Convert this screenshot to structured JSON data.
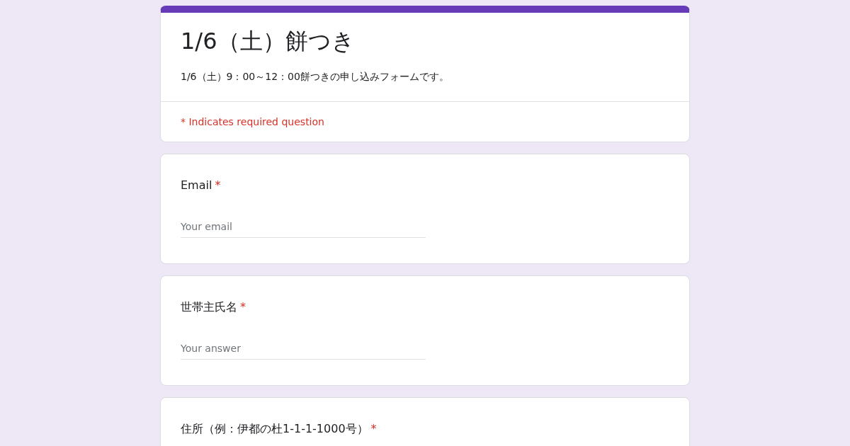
{
  "header": {
    "title": "1/6（土）餅つき",
    "description": "1/6（土）9：00～12：00餅つきの申し込みフォームです。",
    "required_note": "* Indicates required question"
  },
  "questions": [
    {
      "label": "Email",
      "required_mark": "*",
      "placeholder": "Your email"
    },
    {
      "label": "世帯主氏名",
      "required_mark": "*",
      "placeholder": "Your answer"
    },
    {
      "label": "住所（例：伊都の杜1-1-1-1000号）",
      "required_mark": "*"
    }
  ]
}
